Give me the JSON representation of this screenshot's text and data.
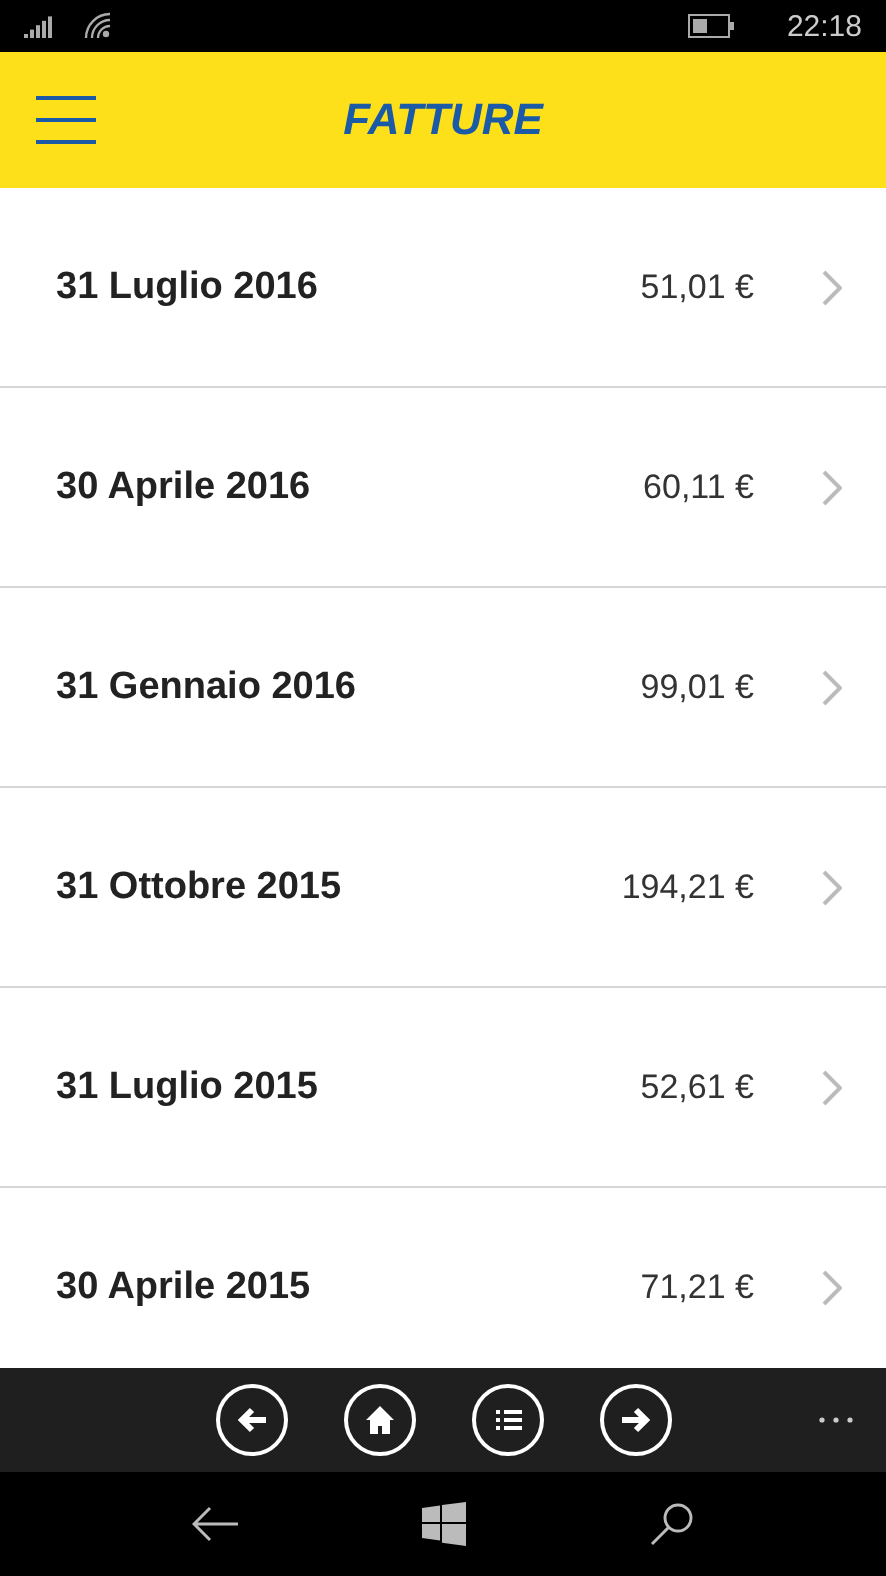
{
  "status_bar": {
    "time": "22:18"
  },
  "header": {
    "title": "FATTURE"
  },
  "invoices": [
    {
      "date": "31 Luglio 2016",
      "amount": "51,01 €"
    },
    {
      "date": "30 Aprile 2016",
      "amount": "60,11 €"
    },
    {
      "date": "31 Gennaio 2016",
      "amount": "99,01 €"
    },
    {
      "date": "31 Ottobre 2015",
      "amount": "194,21 €"
    },
    {
      "date": "31 Luglio 2015",
      "amount": "52,61 €"
    },
    {
      "date": "30 Aprile 2015",
      "amount": "71,21 €"
    }
  ],
  "app_bar": {
    "buttons": [
      {
        "kind": "back"
      },
      {
        "kind": "home"
      },
      {
        "kind": "list"
      },
      {
        "kind": "forward"
      }
    ]
  }
}
